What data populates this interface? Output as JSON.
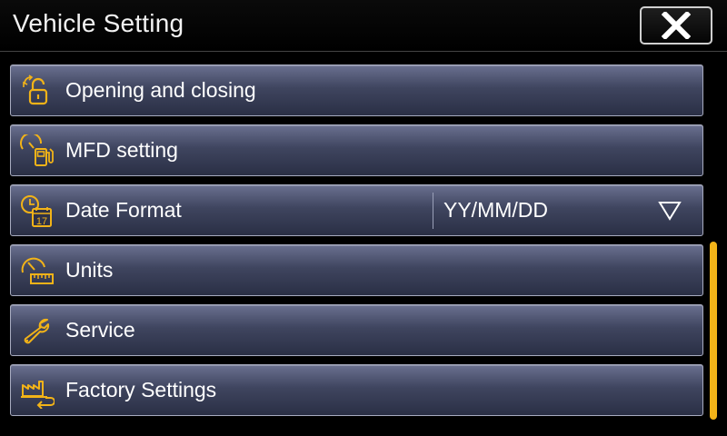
{
  "header": {
    "title": "Vehicle Setting",
    "close_icon": "close-icon"
  },
  "menu": {
    "items": [
      {
        "label": "Opening and closing",
        "icon": "unlock-icon"
      },
      {
        "label": "MFD setting",
        "icon": "mfd-icon"
      },
      {
        "label": "Date Format",
        "icon": "calendar-clock-icon",
        "value": "YY/MM/DD",
        "control": "dropdown"
      },
      {
        "label": "Units",
        "icon": "units-gauge-icon"
      },
      {
        "label": "Service",
        "icon": "wrench-icon"
      },
      {
        "label": "Factory Settings",
        "icon": "factory-reset-icon"
      }
    ]
  },
  "colors": {
    "accent": "#F2B318",
    "row_border": "#A8ACC0",
    "text": "#FFFFFF"
  }
}
